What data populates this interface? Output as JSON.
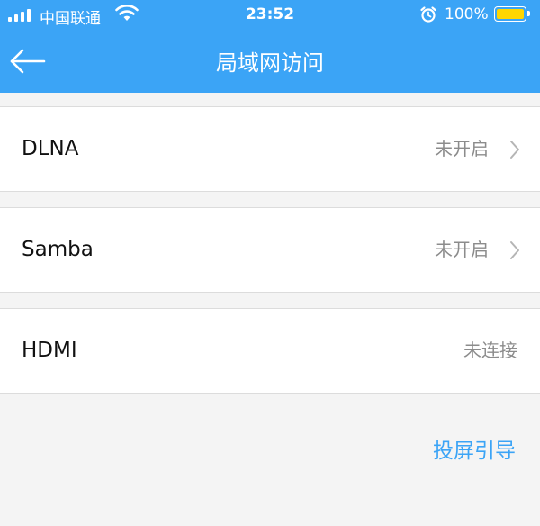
{
  "status_bar": {
    "carrier": "中国联通",
    "time": "23:52",
    "battery": "100%"
  },
  "header": {
    "title": "局域网访问"
  },
  "items": [
    {
      "label": "DLNA",
      "status": "未开启"
    },
    {
      "label": "Samba",
      "status": "未开启"
    },
    {
      "label": "HDMI",
      "status": "未连接"
    }
  ],
  "footer": {
    "guide_link": "投屏引导"
  },
  "colors": {
    "header_bg": "#3ba4f6",
    "accent": "#3ba4f6",
    "battery_fill": "#ffd600"
  }
}
